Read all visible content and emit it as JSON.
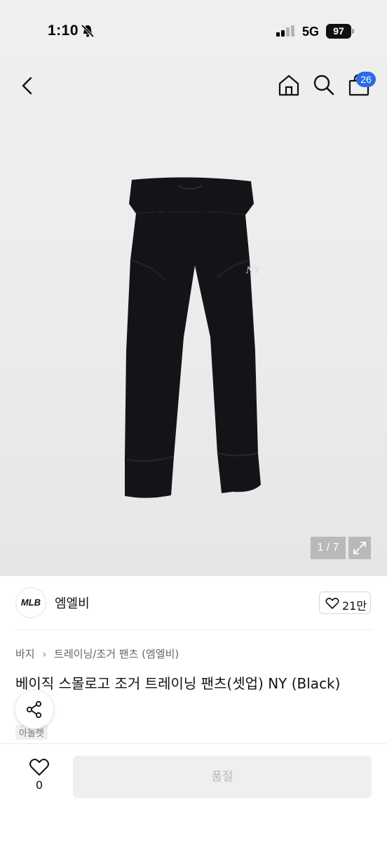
{
  "status_bar": {
    "time": "1:10",
    "network": "5G",
    "battery": "97"
  },
  "header": {
    "cart_count": "26"
  },
  "gallery": {
    "counter": "1 / 7"
  },
  "seller": {
    "logo_text": "MLB",
    "name": "엠엘비",
    "likes": "21만"
  },
  "breadcrumb": {
    "category": "바지",
    "subcategory": "트레이닝/조거 팬츠 (엠엘비)"
  },
  "product": {
    "title": "베이직 스몰로고 조거 트레이닝 팬츠(셋업) NY (Black)",
    "brand_tag": "아놀렛"
  },
  "bottom_bar": {
    "wish_count": "0",
    "buy_label": "품절"
  },
  "icons": {
    "back": "chevron-left-icon",
    "home": "home-icon",
    "search": "search-icon",
    "cart": "bag-icon",
    "expand": "expand-icon",
    "heart": "heart-icon",
    "share": "share-icon",
    "bell": "bell-slash-icon"
  },
  "colors": {
    "badge": "#2c6ae6",
    "disabled_button": "#efefef"
  }
}
